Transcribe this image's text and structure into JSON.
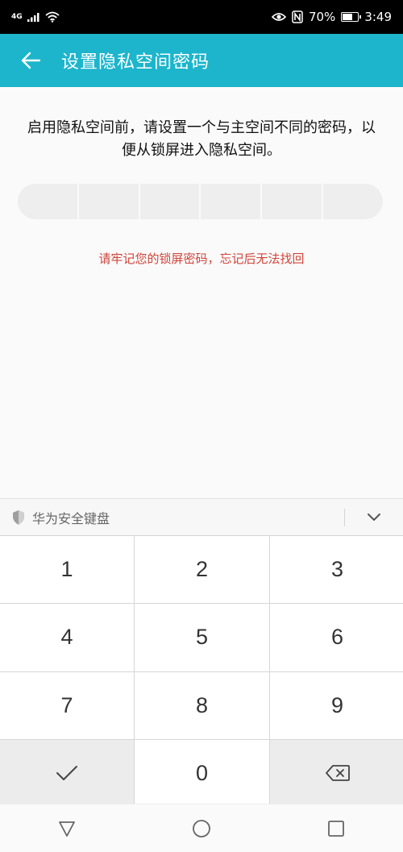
{
  "status_bar": {
    "network": "4G",
    "battery_percent": "70%",
    "battery_level": 0.7,
    "time": "3:49"
  },
  "app_bar": {
    "title": "设置隐私空间密码"
  },
  "main": {
    "instructions": "启用隐私空间前，请设置一个与主空间不同的密码，以便从锁屏进入隐私空间。",
    "warning": "请牢记您的锁屏密码，忘记后无法找回",
    "pin_length": 6
  },
  "keyboard": {
    "brand": "华为安全键盘",
    "keys": [
      "1",
      "2",
      "3",
      "4",
      "5",
      "6",
      "7",
      "8",
      "9",
      "0"
    ]
  },
  "colors": {
    "accent": "#1cb5cc",
    "warning": "#d0453a"
  }
}
